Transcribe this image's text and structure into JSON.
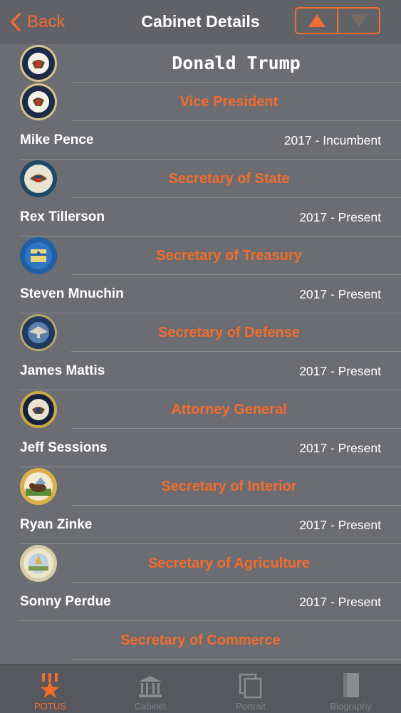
{
  "navbar": {
    "back_label": "Back",
    "title": "Cabinet Details"
  },
  "president": {
    "name": "Donald Trump"
  },
  "cabinet": [
    {
      "role": "Vice President",
      "name": "Mike Pence",
      "term": "2017 - Incumbent",
      "seal": "vice-president-seal-icon"
    },
    {
      "role": "Secretary of State",
      "name": "Rex Tillerson",
      "term": "2017 - Present",
      "seal": "state-department-seal-icon"
    },
    {
      "role": "Secretary of Treasury",
      "name": "Steven Mnuchin",
      "term": "2017 - Present",
      "seal": "treasury-seal-icon"
    },
    {
      "role": "Secretary of Defense",
      "name": "James Mattis",
      "term": "2017 - Present",
      "seal": "defense-seal-icon"
    },
    {
      "role": "Attorney General",
      "name": "Jeff Sessions",
      "term": "2017 - Present",
      "seal": "justice-seal-icon"
    },
    {
      "role": "Secretary of Interior",
      "name": "Ryan Zinke",
      "term": "2017 - Present",
      "seal": "interior-seal-icon"
    },
    {
      "role": "Secretary of Agriculture",
      "name": "Sonny Perdue",
      "term": "2017 - Present",
      "seal": "agriculture-seal-icon"
    },
    {
      "role": "Secretary of Commerce"
    }
  ],
  "tabs": [
    {
      "label": "POTUS",
      "icon": "star-pillars-icon"
    },
    {
      "label": "Cabinet",
      "icon": "building-icon"
    },
    {
      "label": "Portrait",
      "icon": "stacked-frames-icon"
    },
    {
      "label": "Biography",
      "icon": "book-icon"
    }
  ],
  "colors": {
    "accent": "#f26c2d",
    "background": "#6b6d72",
    "navbar": "#606267",
    "tabbar": "#56585d"
  }
}
